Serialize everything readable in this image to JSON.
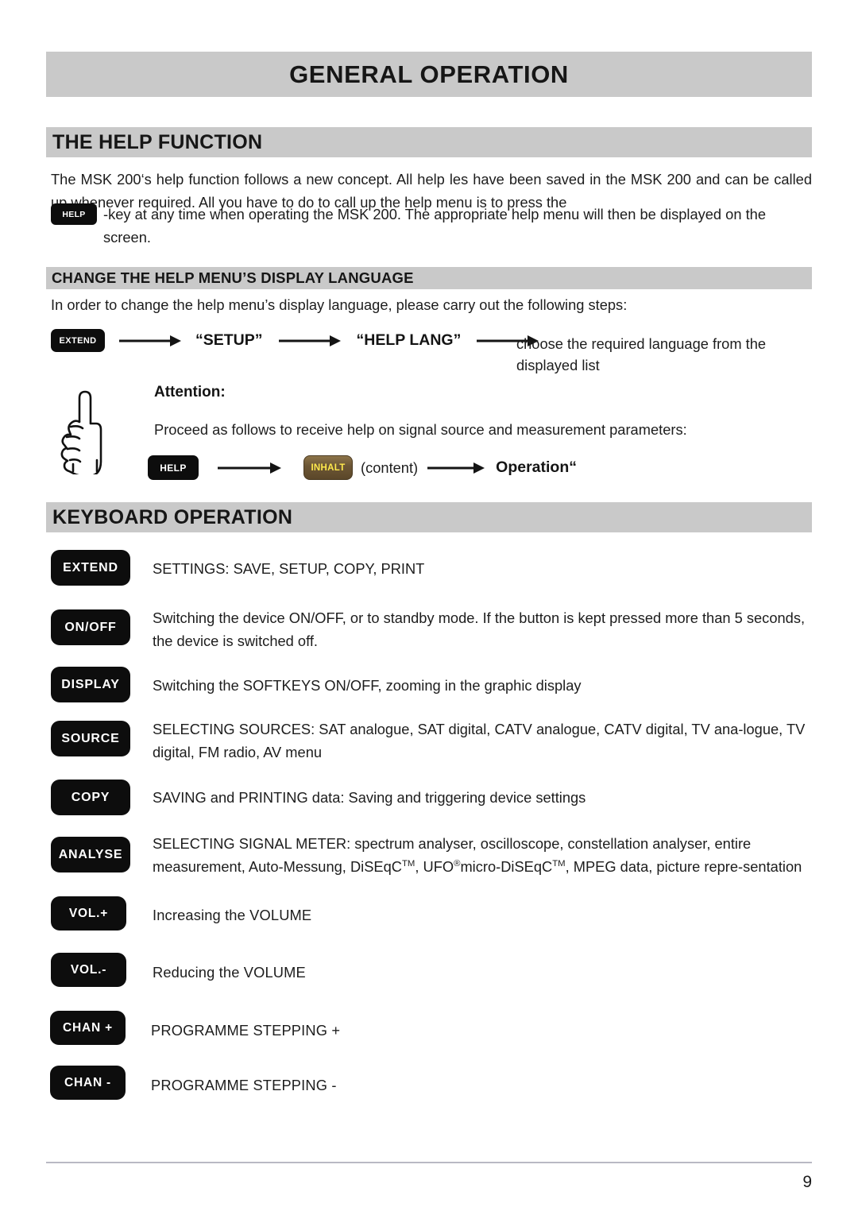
{
  "page": {
    "title": "GENERAL OPERATION",
    "number": "9"
  },
  "help_function": {
    "heading": "THE HELP FUNCTION",
    "para_part1": "The MSK 200‘s help function follows a new concept. All help  les have been saved in the MSK 200 and can be called up whenever required. All you have to do to call up the help menu is to press the",
    "inline_key": "HELP",
    "para_part2": "-key at any time when operating the MSK 200. The appropriate help menu will then be displayed on the screen."
  },
  "change_language": {
    "heading": "CHANGE THE HELP MENU’S DISPLAY LANGUAGE",
    "intro": "In order to change the help menu’s display language, please carry out the following steps:",
    "flow": {
      "key": "EXTEND",
      "step1": "“SETUP”",
      "step2": "“HELP LANG”",
      "result_line1": "choose the required language from the",
      "result_line2": "displayed list"
    }
  },
  "attention": {
    "icon": "pointing-hand-icon",
    "title": "Attention:",
    "text": "Proceed as follows to receive help on signal source and measurement parameters:",
    "flow": {
      "key_help": "HELP",
      "key_inhalt": "INHALT",
      "content_note": "(content)",
      "result": "Operation“"
    }
  },
  "keyboard_operation": {
    "heading": "KEYBOARD OPERATION",
    "rows": [
      {
        "key": "EXTEND",
        "desc": "SETTINGS: SAVE, SETUP, COPY, PRINT"
      },
      {
        "key": "ON/OFF",
        "desc": "Switching the device ON/OFF, or to standby mode. If the button is kept pressed more than 5 seconds, the device is switched off."
      },
      {
        "key": "DISPLAY",
        "desc": "Switching the SOFTKEYS ON/OFF, zooming in the graphic display"
      },
      {
        "key": "SOURCE",
        "desc": "SELECTING SOURCES: SAT analogue, SAT digital, CATV analogue, CATV digital, TV ana-logue, TV digital, FM radio, AV menu"
      },
      {
        "key": "COPY",
        "desc": "SAVING and PRINTING data: Saving and triggering device settings"
      },
      {
        "key": "ANALYSE",
        "desc_pre": "SELECTING SIGNAL METER: spectrum analyser, oscilloscope, constellation analyser, entire measurement, Auto-Messung, DiSEqC",
        "mark_tm_1": "TM",
        "desc_mid": ", UFO",
        "mark_reg": "®",
        "desc_mid2": "micro-DiSEqC",
        "mark_tm_2": "TM",
        "desc_post": ", MPEG data, picture repre-sentation"
      },
      {
        "key": "VOL.+",
        "desc": "Increasing the VOLUME"
      },
      {
        "key": "VOL.-",
        "desc": "Reducing the VOLUME"
      },
      {
        "key": "CHAN +",
        "desc": "PROGRAMME STEPPING +"
      },
      {
        "key": "CHAN -",
        "desc": "PROGRAMME STEPPING -"
      }
    ]
  },
  "colors": {
    "heading_bar": "#c9c9c9",
    "key_black": "#0d0d0d",
    "key_inhalt_body": "#6d5736",
    "key_inhalt_text": "#ffe94d",
    "rule": "#b9b9c4"
  }
}
